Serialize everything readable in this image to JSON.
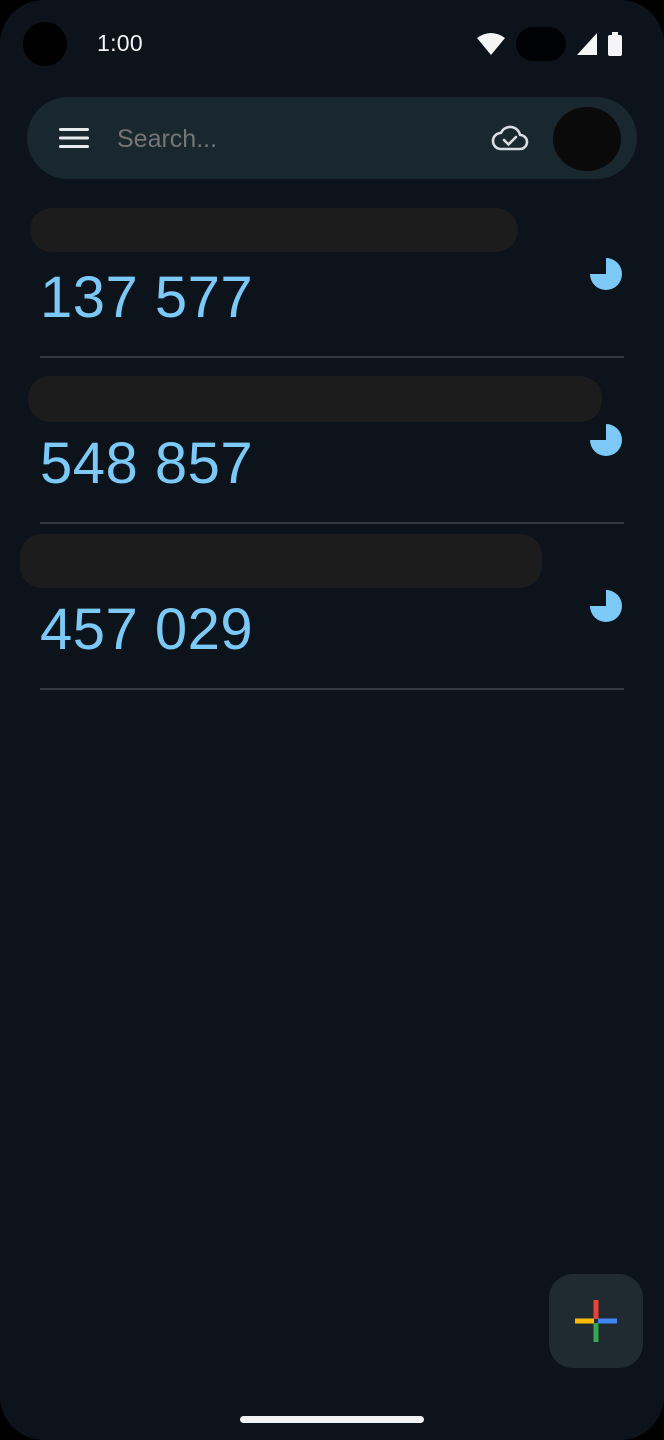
{
  "status_bar": {
    "time": "1:00"
  },
  "search": {
    "placeholder": "Search..."
  },
  "accounts": [
    {
      "code": "137 577",
      "icon": "timer-pie-icon"
    },
    {
      "code": "548 857",
      "icon": "timer-pie-icon"
    },
    {
      "code": "457 029",
      "icon": "timer-pie-icon"
    }
  ],
  "colors": {
    "background": "#0c131b",
    "search_bar": "#19272f",
    "code_text": "#7cc8f7",
    "fab": "#1f2a31"
  },
  "icons": {
    "menu": "hamburger-menu-icon",
    "sync": "cloud-check-icon",
    "add": "google-plus-icon"
  }
}
